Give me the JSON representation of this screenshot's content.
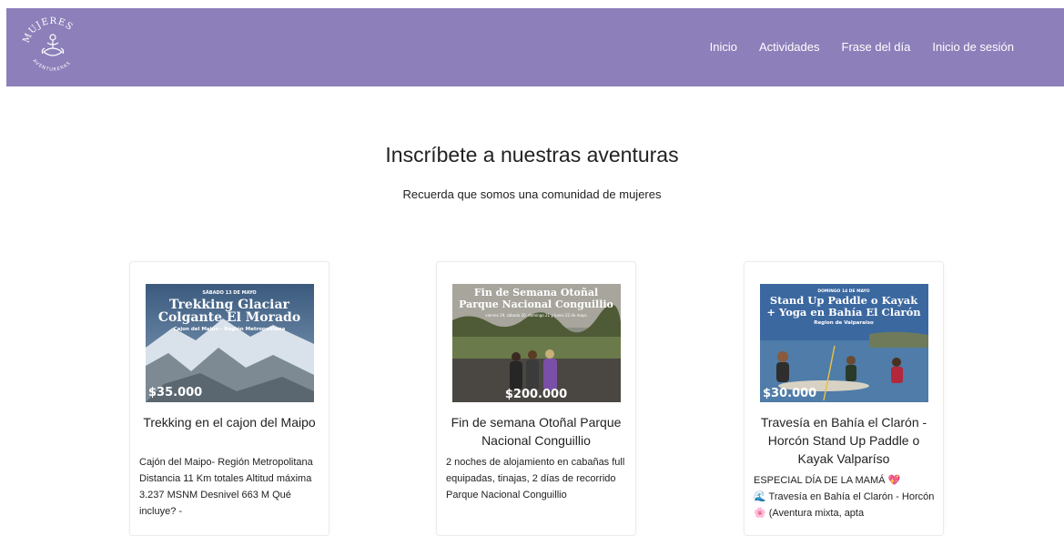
{
  "brand": {
    "logo_text_top": "MUJERES",
    "logo_text_bottom": "AVENTURERAS",
    "nav_color": "#8c7fba"
  },
  "nav": {
    "items": [
      "Inicio",
      "Actividades",
      "Frase del día",
      "Inicio de sesión"
    ]
  },
  "hero": {
    "title": "Inscríbete a nuestras aventuras",
    "subtitle": "Recuerda que somos una comunidad de mujeres"
  },
  "cards": [
    {
      "image": {
        "date": "SÁBADO 13 DE MAYO",
        "title_line1": "Trekking Glaciar",
        "title_line2": "Colgante El Morado",
        "place": "Cajon del Maipo - Región Metropolitana",
        "price": "$35.000"
      },
      "title": "Trekking en el cajon del Maipo",
      "text": "Cajón del Maipo- Región Metropolitana Distancia 11 Km totales Altitud máxima 3.237 MSNM Desnivel 663 M Qué incluye? -"
    },
    {
      "image": {
        "title_line1": "Fin de Semana Otoñal",
        "title_line2": "Parque Nacional Conguillio",
        "dates": "viernes 19, sábado 20, domingo 21 y lunes 22 de mayo",
        "price": "$200.000"
      },
      "title": "Fin de semana Otoñal Parque Nacional Conguillio",
      "text": "2 noches de alojamiento en cabañas full equipadas, tinajas, 2 días de recorrido Parque Nacional Conguillio"
    },
    {
      "image": {
        "date": "DOMINGO 14 DE MAYO",
        "title_line1": "Stand Up Paddle o Kayak",
        "title_line2": "+ Yoga en Bahía El Clarón",
        "place": "Region de Valparaiso",
        "price": "$30.000"
      },
      "title": "Travesía en Bahía el Clarón - Horcón Stand Up Paddle o Kayak Valparíso",
      "text": "ESPECIAL DÍA DE LA MAMÁ 💖\n🌊 Travesía en Bahía el Clarón - Horcón 🌸 (Aventura mixta, apta"
    }
  ]
}
